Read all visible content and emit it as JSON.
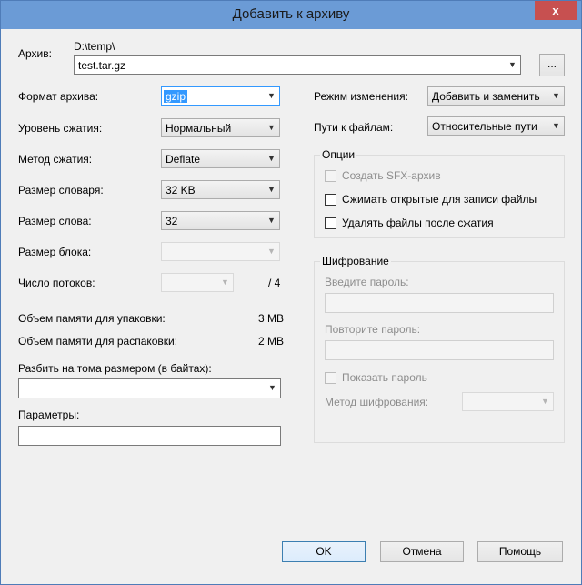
{
  "window": {
    "title": "Добавить к архиву",
    "close_glyph": "x"
  },
  "archive": {
    "label": "Архив:",
    "path": "D:\\temp\\",
    "filename": "test.tar.gz",
    "browse_label": "..."
  },
  "left": {
    "format_label": "Формат архива:",
    "format_value": "gzip",
    "level_label": "Уровень сжатия:",
    "level_value": "Нормальный",
    "method_label": "Метод сжатия:",
    "method_value": "Deflate",
    "dict_label": "Размер словаря:",
    "dict_value": "32 KB",
    "word_label": "Размер слова:",
    "word_value": "32",
    "block_label": "Размер блока:",
    "threads_label": "Число потоков:",
    "threads_max": "/ 4",
    "mem_pack_label": "Объем памяти для упаковки:",
    "mem_pack_value": "3 MB",
    "mem_unpack_label": "Объем памяти для распаковки:",
    "mem_unpack_value": "2 MB",
    "split_label": "Разбить на тома размером (в байтах):",
    "params_label": "Параметры:"
  },
  "right": {
    "mode_label": "Режим изменения:",
    "mode_value": "Добавить и заменить",
    "paths_label": "Пути к файлам:",
    "paths_value": "Относительные пути",
    "options": {
      "title": "Опции",
      "sfx": "Создать SFX-архив",
      "compress_open": "Сжимать открытые для записи файлы",
      "delete_after": "Удалять файлы после сжатия"
    },
    "encryption": {
      "title": "Шифрование",
      "enter_password": "Введите пароль:",
      "repeat_password": "Повторите пароль:",
      "show_password": "Показать пароль",
      "method_label": "Метод шифрования:"
    }
  },
  "buttons": {
    "ok": "OK",
    "cancel": "Отмена",
    "help": "Помощь"
  }
}
